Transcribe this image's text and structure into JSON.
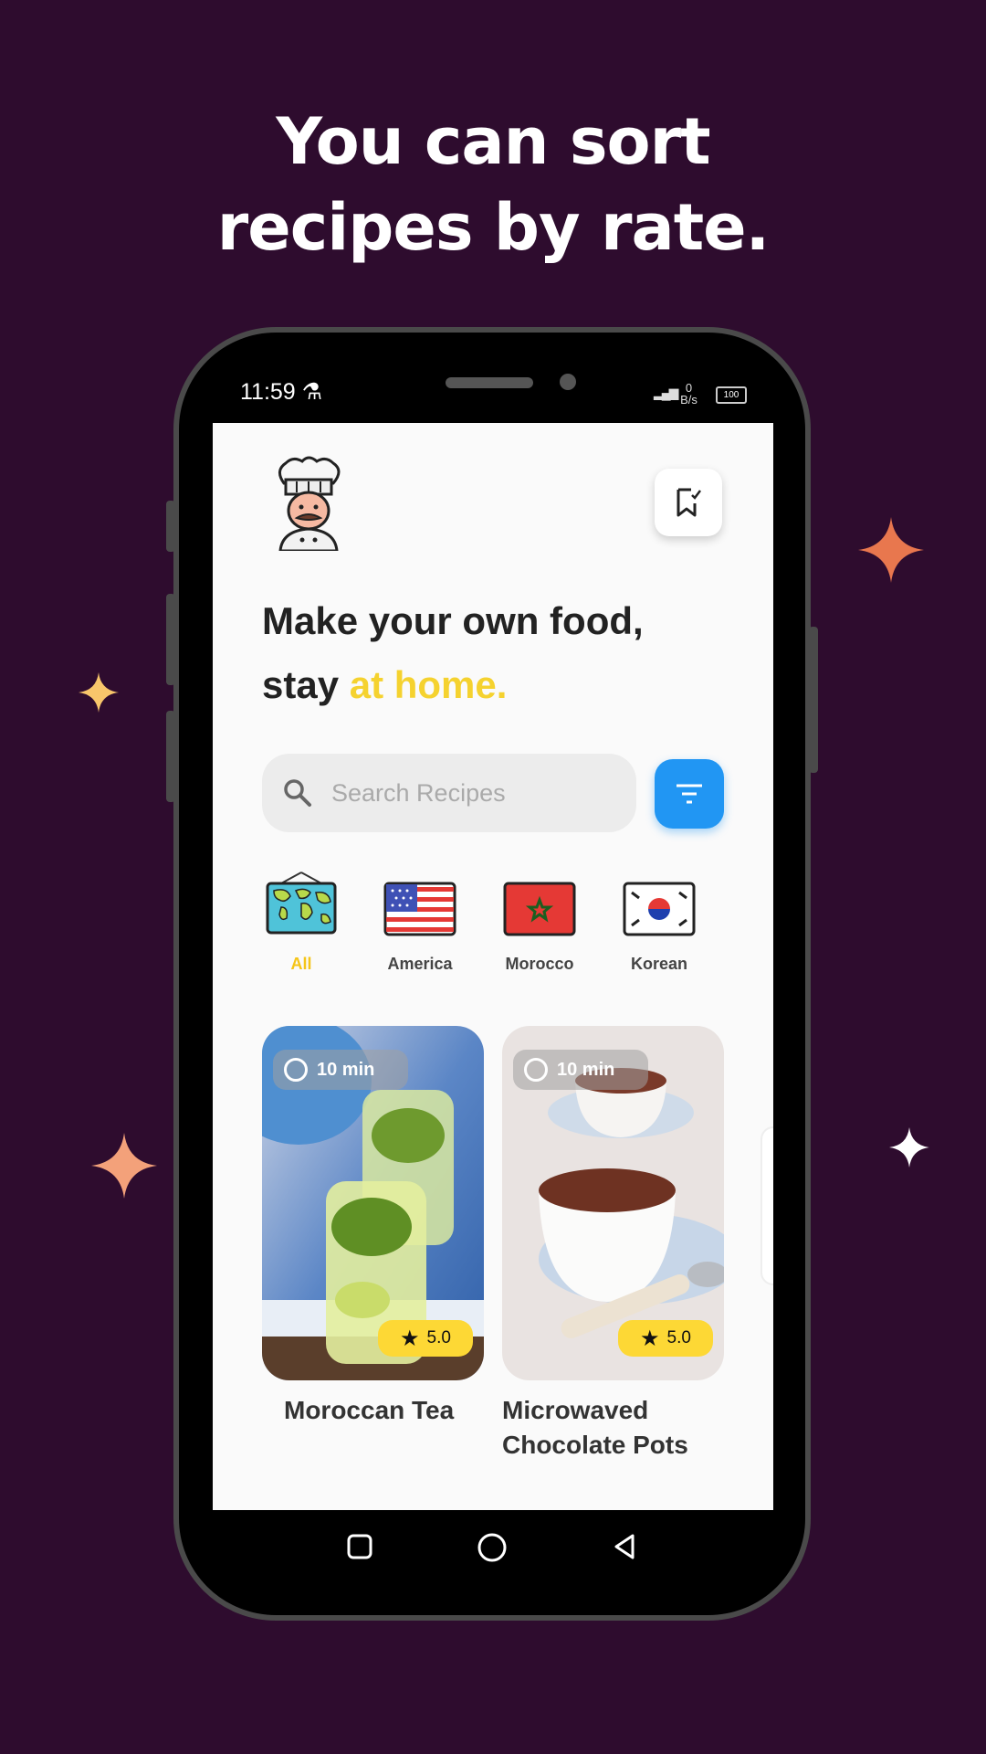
{
  "headline": {
    "line1": "You can sort",
    "line2": "recipes by rate."
  },
  "status_bar": {
    "time": "11:59",
    "net_value": "0",
    "net_unit": "B/s",
    "battery": "100"
  },
  "header": {
    "logo_icon": "chef-icon",
    "saved_icon": "bookmark-check-icon"
  },
  "hero": {
    "line1": "Make your own food,",
    "line2_plain": "stay ",
    "line2_accent": "at home."
  },
  "search": {
    "placeholder": "Search Recipes",
    "icon": "search-icon"
  },
  "filter": {
    "icon": "filter-icon"
  },
  "categories": [
    {
      "label": "All",
      "icon": "world-map-icon",
      "active": true
    },
    {
      "label": "America",
      "icon": "us-flag-icon",
      "active": false
    },
    {
      "label": "Morocco",
      "icon": "morocco-flag-icon",
      "active": false
    },
    {
      "label": "Korean",
      "icon": "korea-flag-icon",
      "active": false
    }
  ],
  "recipes": [
    {
      "title": "Moroccan Tea",
      "time": "10 min",
      "rating": "5.0"
    },
    {
      "title_line1": "Microwaved",
      "title_line2": "Chocolate Pots",
      "time": "10 min",
      "rating": "5.0"
    }
  ],
  "colors": {
    "background": "#2e0c2e",
    "accent_yellow": "#f5d22f",
    "filter_blue": "#2196f3",
    "rating_yellow": "#fdd835"
  }
}
